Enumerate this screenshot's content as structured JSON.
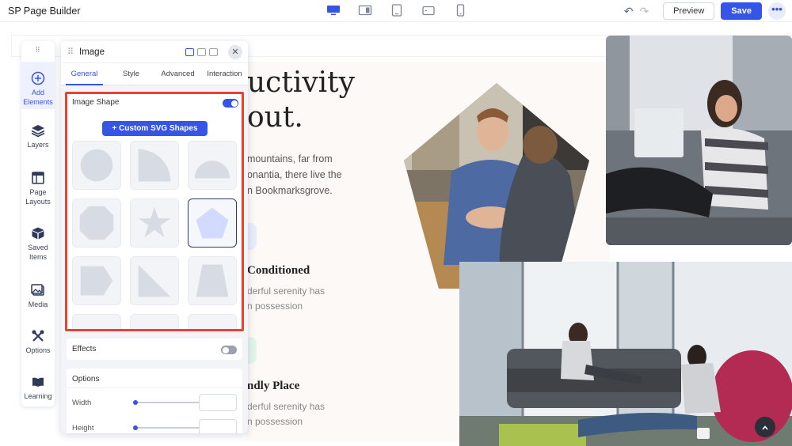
{
  "app": {
    "title": "SP Page Builder"
  },
  "toolbar": {
    "devices": [
      "desktop-icon",
      "laptop-icon",
      "tablet-icon",
      "tablet-landscape-icon",
      "mobile-icon"
    ],
    "undo_icon": "undo-icon",
    "redo_icon": "redo-icon",
    "preview_label": "Preview",
    "save_label": "Save",
    "more_label": "•••",
    "accent_color": "#3555e6"
  },
  "sidebar": {
    "grip": "⠿",
    "items": [
      {
        "label": "Add Elements",
        "icon": "plus-circle-icon",
        "active": true
      },
      {
        "label": "Layers",
        "icon": "layers-icon"
      },
      {
        "label": "Page Layouts",
        "icon": "page-layouts-icon"
      },
      {
        "label": "Saved Items",
        "icon": "box-icon"
      },
      {
        "label": "Media",
        "icon": "image-icon"
      },
      {
        "label": "Options",
        "icon": "tools-icon"
      },
      {
        "label": "Learning",
        "icon": "book-icon"
      }
    ]
  },
  "panel": {
    "title": "Image",
    "tabs": [
      {
        "label": "General",
        "active": true
      },
      {
        "label": "Style"
      },
      {
        "label": "Advanced"
      },
      {
        "label": "Interaction"
      }
    ],
    "image_shape": {
      "label": "Image Shape",
      "enabled": true,
      "custom_button": "+ Custom SVG Shapes",
      "shapes": [
        "circle",
        "quarter-circle",
        "half-circle",
        "octagon",
        "star",
        "pentagon",
        "arrow-pentagon",
        "right-triangle",
        "trapezoid"
      ],
      "selected": "pentagon"
    },
    "effects": {
      "label": "Effects",
      "enabled": false
    },
    "options": {
      "title": "Options",
      "width_label": "Width",
      "height_label": "Height"
    },
    "highlight_color": "#e8432f"
  },
  "canvas": {
    "heading_line1": "uctivity",
    "heading_line2": "out.",
    "paragraph": [
      "mountains, far from",
      "onantia, there live the",
      "n Bookmarksgrove."
    ],
    "feature1": {
      "title": "Conditioned",
      "lines": [
        "derful serenity has",
        "n possession"
      ]
    },
    "feature2": {
      "title": "ndly Place",
      "lines": [
        "derful serenity has",
        "n possession"
      ]
    },
    "scroll_top_icon": "chevron-up-icon"
  }
}
